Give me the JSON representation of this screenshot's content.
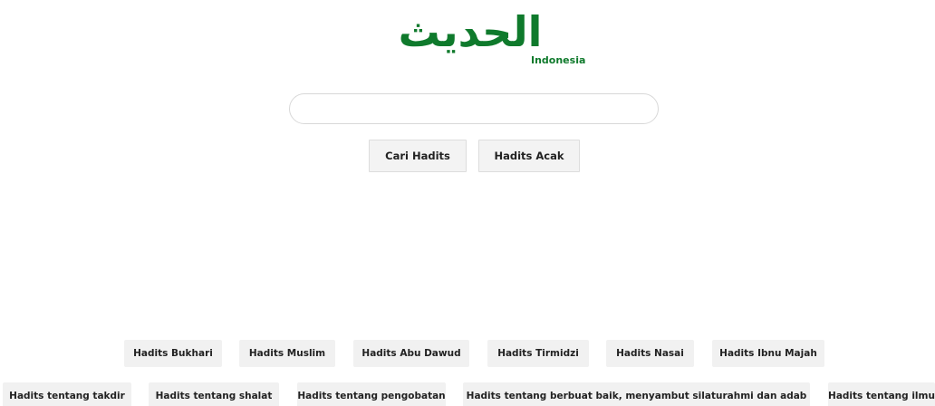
{
  "logo": {
    "arabic": "الحديث",
    "subtitle": "Indonesia",
    "color": "#0f7a2c"
  },
  "search": {
    "value": "",
    "placeholder": ""
  },
  "buttons": {
    "search_label": "Cari Hadits",
    "random_label": "Hadits Acak"
  },
  "collections": [
    "Hadits Bukhari",
    "Hadits Muslim",
    "Hadits Abu Dawud",
    "Hadits Tirmidzi",
    "Hadits Nasai",
    "Hadits Ibnu Majah"
  ],
  "topics": [
    "Hadits tentang takdir",
    "Hadits tentang shalat",
    "Hadits tentang pengobatan",
    "Hadits tentang berbuat baik, menyambut silaturahmi dan adab",
    "Hadits tentang ilmu"
  ]
}
